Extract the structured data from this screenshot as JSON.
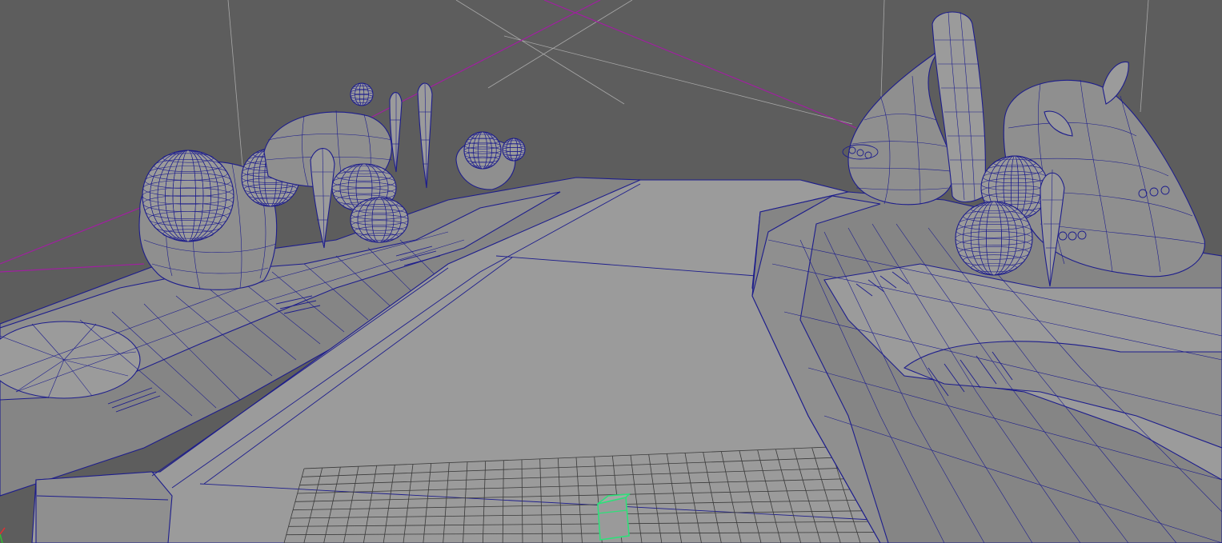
{
  "viewport": {
    "background": "#5d5d5d",
    "mesh_fill": "#8f8f8f",
    "wire_color": "#1d1d8c",
    "camera_line_color": "#a020a0",
    "selected_color": "#2ee07a"
  },
  "objects": [
    "spherical-mushroom-houses-left",
    "road-platform",
    "tall-alien-towers-right",
    "ground-grid",
    "selected-cube"
  ]
}
